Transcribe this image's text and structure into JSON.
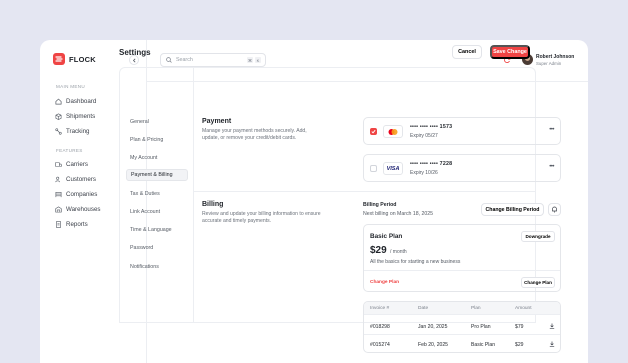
{
  "brand": {
    "name": "FLOCK"
  },
  "sidebar": {
    "main_label": "MAIN MENU",
    "main_items": [
      {
        "label": "Dashboard",
        "icon": "home-icon"
      },
      {
        "label": "Shipments",
        "icon": "box-icon"
      },
      {
        "label": "Tracking",
        "icon": "tracking-icon"
      }
    ],
    "features_label": "FEATURES",
    "feature_items": [
      {
        "label": "Carriers",
        "icon": "truck-icon"
      },
      {
        "label": "Customers",
        "icon": "users-icon"
      },
      {
        "label": "Companies",
        "icon": "building-icon"
      },
      {
        "label": "Warehouses",
        "icon": "warehouse-icon"
      },
      {
        "label": "Reports",
        "icon": "report-icon"
      }
    ]
  },
  "topbar": {
    "search_placeholder": "Search",
    "shortcut_keys": [
      "⌘",
      "K"
    ],
    "user": {
      "name": "Robert Johnson",
      "role": "Super Admin"
    }
  },
  "page": {
    "title": "Settings",
    "cancel_label": "Cancel",
    "save_label": "Save Change"
  },
  "subnav": [
    {
      "label": "General",
      "active": false
    },
    {
      "label": "Plan & Pricing",
      "active": false
    },
    {
      "label": "My Account",
      "active": false
    },
    {
      "label": "Payment & Billing",
      "active": true
    },
    {
      "label": "Tax & Duties",
      "active": false
    },
    {
      "label": "Link Account",
      "active": false
    },
    {
      "label": "Time & Language",
      "active": false
    },
    {
      "label": "Password",
      "active": false
    },
    {
      "label": "Notifications",
      "active": false
    }
  ],
  "payment": {
    "title": "Payment",
    "description": "Manage your payment methods securely. Add, update, or remove your credit/debit cards.",
    "cards": [
      {
        "brand": "mastercard",
        "number": "•••• •••• •••• 1573",
        "expiry": "Expiry 05/27",
        "selected": true
      },
      {
        "brand": "VISA",
        "number": "•••• •••• •••• 7228",
        "expiry": "Expiry 10/26",
        "selected": false
      }
    ]
  },
  "billing": {
    "title": "Billing",
    "description": "Review and update your billing information to ensure accurate and timely payments.",
    "period_label": "Billing Period",
    "next_billing": "Next billing on March 18, 2025",
    "change_period_label": "Change Billing Period",
    "plan": {
      "name": "Basic Plan",
      "price": "$29",
      "period": "/ month",
      "description": "All the basics for starting a new business",
      "downgrade_label": "Downgrade",
      "change_link": "Change Plan",
      "change_button": "Change Plan"
    },
    "invoices": {
      "headers": [
        "Invoice #",
        "Date",
        "Plan",
        "Amount"
      ],
      "rows": [
        {
          "id": "#018298",
          "date": "Jan 20, 2025",
          "plan": "Pro Plan",
          "amount": "$79"
        },
        {
          "id": "#015274",
          "date": "Feb 20, 2025",
          "plan": "Basic Plan",
          "amount": "$29"
        }
      ]
    }
  },
  "colors": {
    "accent": "#ef4444",
    "background": "#e4e6f2"
  }
}
